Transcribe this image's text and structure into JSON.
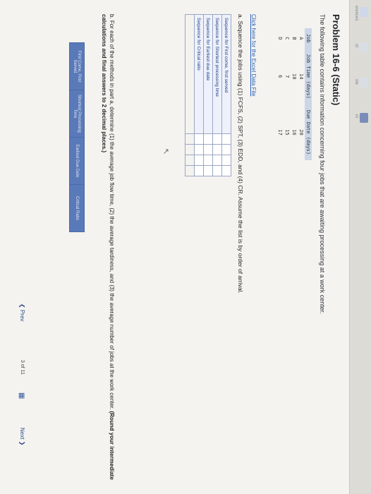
{
  "left_rail": {
    "labels": [
      "erences",
      "ot",
      "ole",
      "nt"
    ]
  },
  "problem": {
    "title": "Problem 16-6 (Static)",
    "intro": "The following table contains information concerning four jobs that are awaiting processing at a work center.",
    "table": {
      "headers": [
        "Job",
        "Job Time (days)",
        "Due Date (days)"
      ],
      "rows": [
        [
          "A",
          "14",
          "20"
        ],
        [
          "B",
          "10",
          "16"
        ],
        [
          "C",
          "7",
          "15"
        ],
        [
          "D",
          "6",
          "17"
        ]
      ]
    },
    "excel_link": "Click here for the Excel Data File",
    "part_a": "a. Sequence the jobs using (1) FCFS, (2) SPT, (3) EDD, and (4) CR. Assume the list is by order of arrival.",
    "answer_rows": [
      "Sequence for First come, first served",
      "Sequence for Shortest processing time",
      "Sequence for Earliest due date",
      "Sequence for Critical ratio"
    ],
    "part_b_plain": "b. For each of the methods in part a, determine (1) the average job flow time, (2) the average tardiness, and (3) the average number of jobs at the work center.",
    "part_b_bold": "(Round your intermediate calculations and final answers to 2 decimal places.)",
    "avg_headers": [
      "First Come, First Served",
      "Shortest Processing Time",
      "Earliest Due Date",
      "Critical Ratio"
    ]
  },
  "nav": {
    "prev_label": "Prev",
    "page_current": "3",
    "page_of": "of",
    "page_total": "11",
    "next_label": "Next"
  },
  "colors": {
    "accent": "#2c62b8",
    "header_blue": "#5a79b8"
  }
}
